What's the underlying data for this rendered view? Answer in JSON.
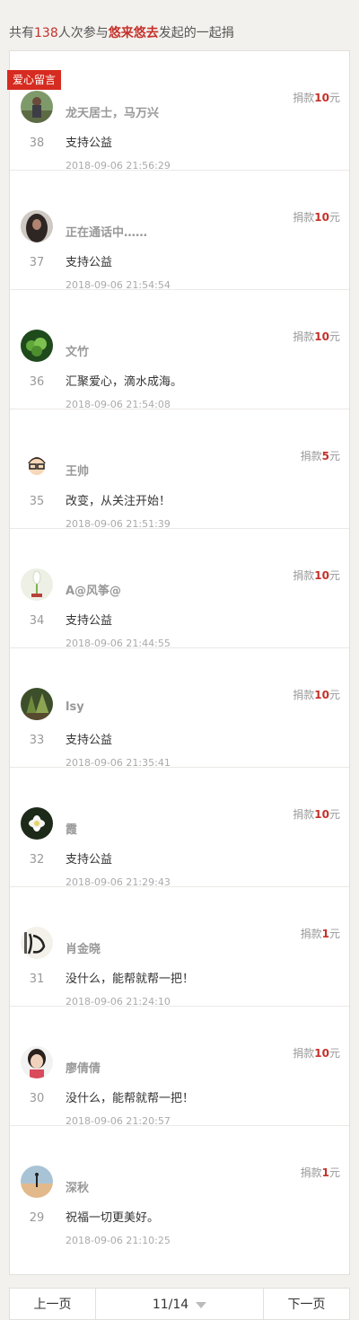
{
  "summary": {
    "prefix": "共有",
    "count": "138",
    "middle": "人次参与",
    "initiator": "悠来悠去",
    "suffix": "发起的一起捐"
  },
  "tag": "爱心留言",
  "amount_prefix": "捐款",
  "amount_suffix": "元",
  "messages": [
    {
      "index": "38",
      "name": "龙天居士，马万兴",
      "amount": "10",
      "text": "支持公益",
      "time": "2018-09-06 21:56:29",
      "avatar": "person-outdoor-avatar"
    },
    {
      "index": "37",
      "name": "正在通话中……",
      "amount": "10",
      "text": "支持公益",
      "time": "2018-09-06 21:54:54",
      "avatar": "dark-portrait-avatar"
    },
    {
      "index": "36",
      "name": "文竹",
      "amount": "10",
      "text": "汇聚爱心，滴水成海。",
      "time": "2018-09-06 21:54:08",
      "avatar": "green-plant-avatar"
    },
    {
      "index": "35",
      "name": "王帅",
      "amount": "5",
      "text": "改变，从关注开始！",
      "time": "2018-09-06 21:51:39",
      "avatar": "cartoon-glasses-avatar"
    },
    {
      "index": "34",
      "name": "A@风筝@",
      "amount": "10",
      "text": "支持公益",
      "time": "2018-09-06 21:44:55",
      "avatar": "white-flower-avatar"
    },
    {
      "index": "33",
      "name": "lsy",
      "amount": "10",
      "text": "支持公益",
      "time": "2018-09-06 21:35:41",
      "avatar": "forest-avatar"
    },
    {
      "index": "32",
      "name": "霞",
      "amount": "10",
      "text": "支持公益",
      "time": "2018-09-06 21:29:43",
      "avatar": "lotus-avatar"
    },
    {
      "index": "31",
      "name": "肖金晓",
      "amount": "1",
      "text": "没什么，能帮就帮一把！",
      "time": "2018-09-06 21:24:10",
      "avatar": "calligraphy-avatar"
    },
    {
      "index": "30",
      "name": "廖倩倩",
      "amount": "10",
      "text": "没什么，能帮就帮一把！",
      "time": "2018-09-06 21:20:57",
      "avatar": "girl-portrait-avatar"
    },
    {
      "index": "29",
      "name": "深秋",
      "amount": "1",
      "text": "祝福一切更美好。",
      "time": "2018-09-06 21:10:25",
      "avatar": "sunset-beach-avatar"
    }
  ],
  "pager": {
    "prev": "上一页",
    "current": "11/14",
    "next": "下一页"
  }
}
